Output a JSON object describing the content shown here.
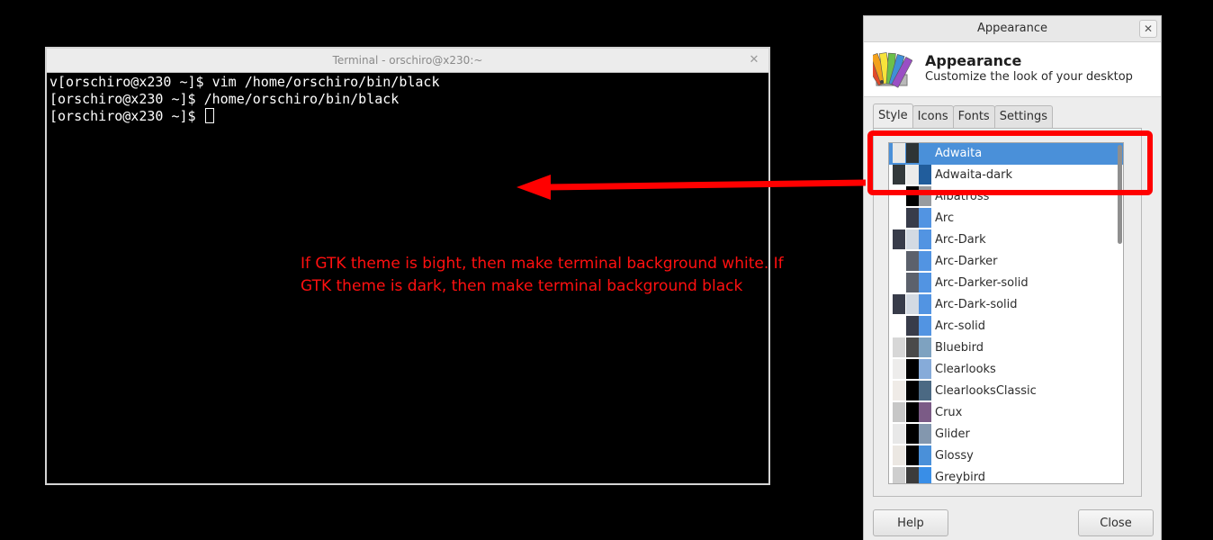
{
  "terminal": {
    "title": "Terminal - orschiro@x230:~",
    "lines": [
      "v[orschiro@x230 ~]$ vim /home/orschiro/bin/black",
      "[orschiro@x230 ~]$ /home/orschiro/bin/black",
      "[orschiro@x230 ~]$ "
    ]
  },
  "annotation": {
    "text": "If GTK theme is bight, then make terminal background white. If GTK theme is dark, then make terminal background black",
    "color": "#ff1010"
  },
  "appearance": {
    "window_title": "Appearance",
    "header_title": "Appearance",
    "header_subtitle": "Customize the look of your desktop",
    "tabs": [
      "Style",
      "Icons",
      "Fonts",
      "Settings"
    ],
    "themes": [
      {
        "name": "Adwaita",
        "selected": true,
        "c1": "#e8e8e7",
        "c2": "#2e3436",
        "c3": "#4a90d9"
      },
      {
        "name": "Adwaita-dark",
        "selected": false,
        "c1": "#33393b",
        "c2": "#ebebea",
        "c3": "#215d9c"
      },
      {
        "name": "Albatross",
        "selected": false,
        "c1": "#ffffff",
        "c2": "#000000",
        "c3": "#979b9f"
      },
      {
        "name": "Arc",
        "selected": false,
        "c1": "#ffffff",
        "c2": "#383c4a",
        "c3": "#5294e2"
      },
      {
        "name": "Arc-Dark",
        "selected": false,
        "c1": "#383c4a",
        "c2": "#d3dae3",
        "c3": "#5294e2"
      },
      {
        "name": "Arc-Darker",
        "selected": false,
        "c1": "#ffffff",
        "c2": "#5c616c",
        "c3": "#5294e2"
      },
      {
        "name": "Arc-Darker-solid",
        "selected": false,
        "c1": "#ffffff",
        "c2": "#5c616c",
        "c3": "#5294e2"
      },
      {
        "name": "Arc-Dark-solid",
        "selected": false,
        "c1": "#383c4a",
        "c2": "#d3dae3",
        "c3": "#5294e2"
      },
      {
        "name": "Arc-solid",
        "selected": false,
        "c1": "#ffffff",
        "c2": "#383c4a",
        "c3": "#5294e2"
      },
      {
        "name": "Bluebird",
        "selected": false,
        "c1": "#d7d7d7",
        "c2": "#4a4a4a",
        "c3": "#7ea2c0"
      },
      {
        "name": "Clearlooks",
        "selected": false,
        "c1": "#edeceb",
        "c2": "#000000",
        "c3": "#86abd9"
      },
      {
        "name": "ClearlooksClassic",
        "selected": false,
        "c1": "#efebe7",
        "c2": "#000000",
        "c3": "#4b6983"
      },
      {
        "name": "Crux",
        "selected": false,
        "c1": "#c7c7c7",
        "c2": "#000000",
        "c3": "#7b5b86"
      },
      {
        "name": "Glider",
        "selected": false,
        "c1": "#e8e8e8",
        "c2": "#000000",
        "c3": "#8397ae"
      },
      {
        "name": "Glossy",
        "selected": false,
        "c1": "#ebe7e2",
        "c2": "#000000",
        "c3": "#4a90d9"
      },
      {
        "name": "Greybird",
        "selected": false,
        "c1": "#cecece",
        "c2": "#3c3c3c",
        "c3": "#398ee7"
      }
    ],
    "buttons": {
      "help": "Help",
      "close": "Close"
    }
  },
  "highlight_color": "#ff0000"
}
